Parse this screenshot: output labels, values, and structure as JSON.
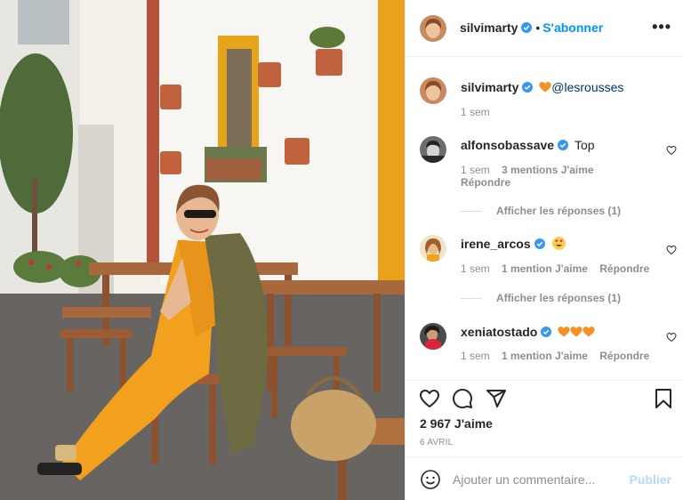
{
  "post": {
    "author": "silvimarty",
    "follow_label": "S'abonner",
    "dot": "•",
    "more": "•••"
  },
  "caption": {
    "author": "silvimarty",
    "text": "@lesrousses",
    "time": "1 sem"
  },
  "comments": [
    {
      "author": "alfonsobassave",
      "text": "Top",
      "time": "1 sem",
      "likes": "3 mentions J'aime",
      "reply": "Répondre",
      "view_replies": "Afficher les réponses (1)"
    },
    {
      "author": "irene_arcos",
      "text": "",
      "time": "1 sem",
      "likes": "1 mention J'aime",
      "reply": "Répondre",
      "view_replies": "Afficher les réponses (1)"
    },
    {
      "author": "xeniatostado",
      "text": "",
      "time": "1 sem",
      "likes": "1 mention J'aime",
      "reply": "Répondre"
    }
  ],
  "stats": {
    "likes": "2 967 J'aime",
    "date": "6 AVRIL"
  },
  "composer": {
    "placeholder": "Ajouter un commentaire...",
    "publish_label": "Publier"
  },
  "colors": {
    "link_blue": "#0095f6",
    "publish_disabled": "#b3dbff",
    "verified": "#3897f0",
    "orange_heart": "#f39223"
  },
  "icons": {
    "like": "heart-icon",
    "comment": "comment-bubble-icon",
    "share": "paper-plane-icon",
    "save": "bookmark-icon",
    "emoji": "smiley-icon",
    "verified": "verified-badge-icon"
  }
}
